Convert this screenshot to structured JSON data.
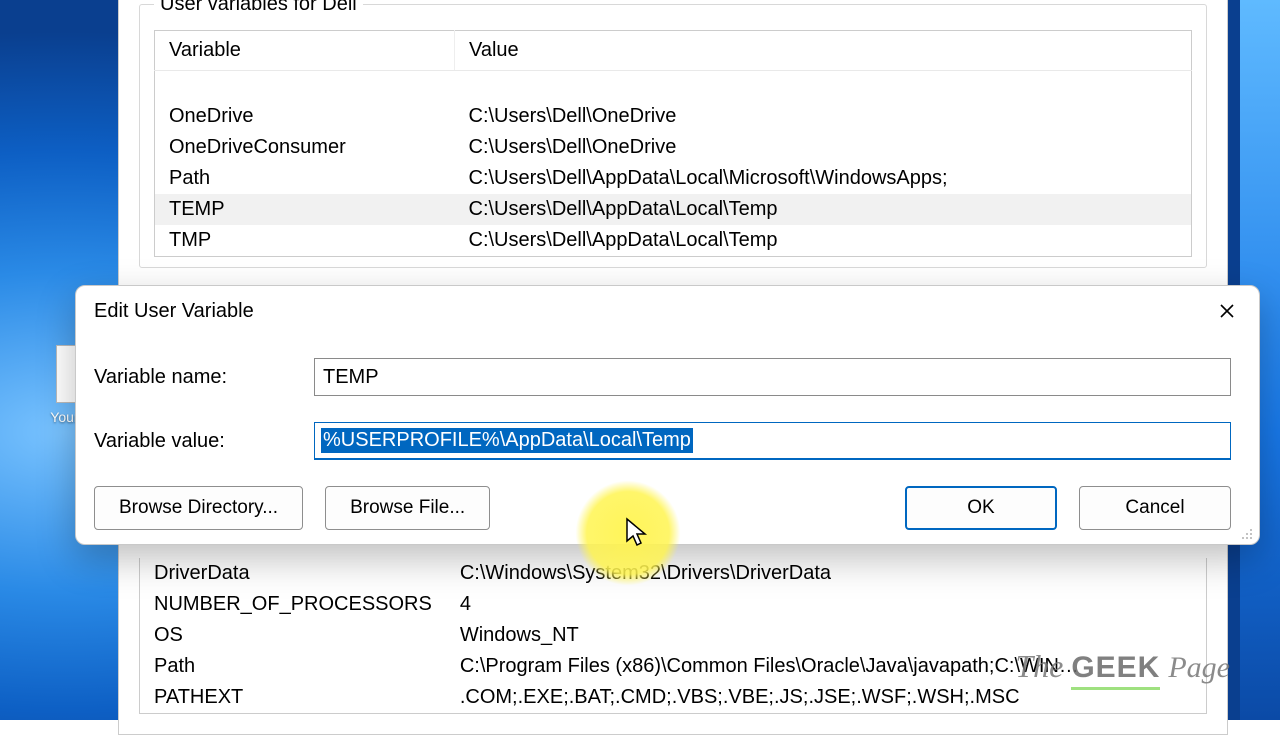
{
  "desktop": {
    "icon_label": "Your data"
  },
  "parent": {
    "group_title": "User variables for Dell",
    "headers": {
      "variable": "Variable",
      "value": "Value"
    },
    "rows": [
      {
        "name": "OneDrive",
        "value": "C:\\Users\\Dell\\OneDrive"
      },
      {
        "name": "OneDriveConsumer",
        "value": "C:\\Users\\Dell\\OneDrive"
      },
      {
        "name": "Path",
        "value": "C:\\Users\\Dell\\AppData\\Local\\Microsoft\\WindowsApps;"
      },
      {
        "name": "TEMP",
        "value": "C:\\Users\\Dell\\AppData\\Local\\Temp"
      },
      {
        "name": "TMP",
        "value": "C:\\Users\\Dell\\AppData\\Local\\Temp"
      }
    ],
    "sys_rows": [
      {
        "name": "DriverData",
        "value": "C:\\Windows\\System32\\Drivers\\DriverData"
      },
      {
        "name": "NUMBER_OF_PROCESSORS",
        "value": "4"
      },
      {
        "name": "OS",
        "value": "Windows_NT"
      },
      {
        "name": "Path",
        "value": "C:\\Program Files (x86)\\Common Files\\Oracle\\Java\\javapath;C:\\WIN…"
      },
      {
        "name": "PATHEXT",
        "value": ".COM;.EXE;.BAT;.CMD;.VBS;.VBE;.JS;.JSE;.WSF;.WSH;.MSC"
      }
    ]
  },
  "modal": {
    "title": "Edit User Variable",
    "name_label": "Variable name:",
    "value_label": "Variable value:",
    "name_value": "TEMP",
    "value_value": "%USERPROFILE%\\AppData\\Local\\Temp",
    "browse_dir": "Browse Directory...",
    "browse_file": "Browse File...",
    "ok": "OK",
    "cancel": "Cancel"
  },
  "watermark": {
    "the": "The",
    "geek": "GEEK",
    "page": "Page"
  }
}
